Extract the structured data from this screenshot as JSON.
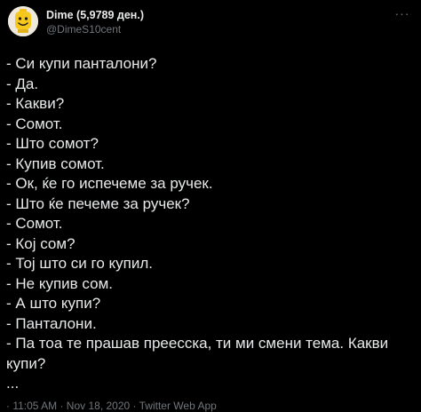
{
  "tweet": {
    "author": {
      "display_name": "Dime (5,9789 ден.)",
      "handle": "@DimeS10cent",
      "avatar_icon": "lego-head-avatar-icon"
    },
    "more_icon": "more-options-icon",
    "more_label": "···",
    "lines": [
      "- Си купи панталони?",
      "- Да.",
      "- Какви?",
      "- Сомот.",
      "- Што сомот?",
      "- Купив сомот.",
      "- Ок, ќе го испечеме за ручек.",
      "- Што ќе печеме за ручек?",
      "- Сомот.",
      "- Кој сом?",
      "- Тој што си го купил.",
      "- Не купив сом.",
      "- А што купи?",
      "- Панталони.",
      "- Па тоа те прашав преесска, ти ми смени тема. Какви купи?",
      "..."
    ],
    "footer": "· 11:05 AM · Nov 18, 2020 · Twitter Web App"
  },
  "colors": {
    "background": "#000000",
    "text": "#e7e9ea",
    "secondary": "#71767b",
    "avatar_yellow": "#f5c518"
  }
}
